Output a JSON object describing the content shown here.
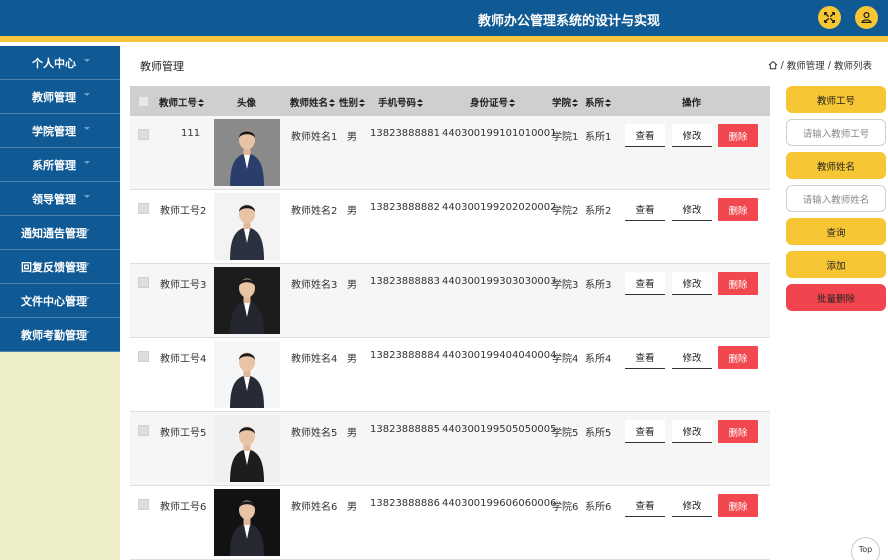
{
  "header": {
    "title": "教师办公管理系统的设计与实现",
    "icons": [
      "fullscreen-icon",
      "user-icon"
    ]
  },
  "sidebar": {
    "items": [
      {
        "label": "个人中心"
      },
      {
        "label": "教师管理"
      },
      {
        "label": "学院管理"
      },
      {
        "label": "系所管理"
      },
      {
        "label": "领导管理"
      },
      {
        "label": "通知通告管理"
      },
      {
        "label": "回复反馈管理"
      },
      {
        "label": "文件中心管理"
      },
      {
        "label": "教师考勤管理"
      }
    ]
  },
  "page": {
    "title": "教师管理",
    "breadcrumb": [
      "教师管理",
      "教师列表"
    ]
  },
  "table": {
    "headers": {
      "id": "教师工号",
      "avatar": "头像",
      "name": "教师姓名",
      "gender": "性别",
      "phone": "手机号码",
      "idcard": "身份证号",
      "college": "学院",
      "dept": "系所",
      "actions": "操作"
    },
    "rows": [
      {
        "id": "111",
        "name": "教师姓名1",
        "gender": "男",
        "phone": "13823888881",
        "idcard": "440300199101010001",
        "college": "学院1",
        "dept": "系所1"
      },
      {
        "id": "教师工号2",
        "name": "教师姓名2",
        "gender": "男",
        "phone": "13823888882",
        "idcard": "440300199202020002",
        "college": "学院2",
        "dept": "系所2"
      },
      {
        "id": "教师工号3",
        "name": "教师姓名3",
        "gender": "男",
        "phone": "13823888883",
        "idcard": "440300199303030003",
        "college": "学院3",
        "dept": "系所3"
      },
      {
        "id": "教师工号4",
        "name": "教师姓名4",
        "gender": "男",
        "phone": "13823888884",
        "idcard": "440300199404040004",
        "college": "学院4",
        "dept": "系所4"
      },
      {
        "id": "教师工号5",
        "name": "教师姓名5",
        "gender": "男",
        "phone": "13823888885",
        "idcard": "440300199505050005",
        "college": "学院5",
        "dept": "系所5"
      },
      {
        "id": "教师工号6",
        "name": "教师姓名6",
        "gender": "男",
        "phone": "13823888886",
        "idcard": "440300199606060006",
        "college": "学院6",
        "dept": "系所6"
      }
    ],
    "actions": {
      "view": "查看",
      "edit": "修改",
      "delete": "删除"
    }
  },
  "search": {
    "id_label": "教师工号",
    "id_placeholder": "请输入教师工号",
    "name_label": "教师姓名",
    "name_placeholder": "请输入教师姓名",
    "query": "查询",
    "add": "添加",
    "batch_delete": "批量删除"
  },
  "back_to_top": "Top",
  "colors": {
    "primary": "#0f5a94",
    "accent": "#f7c634",
    "danger": "#f0484e",
    "sidebar_bg": "#eeeec8"
  }
}
